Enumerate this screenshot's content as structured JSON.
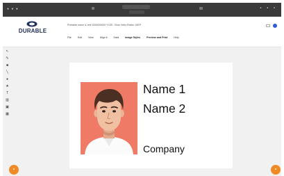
{
  "app": {
    "brand": "DURABLE",
    "tagline": "",
    "file_title": "Printable name & text 0000000000 YLEE. Shoe Hello Ration 15EP"
  },
  "menu": {
    "items": [
      "File",
      "Edit",
      "View",
      "Align it",
      "Data",
      "Image Styles",
      "Preview and Print",
      "Help"
    ]
  },
  "header_right": {
    "left_text": "",
    "button_label": "",
    "avatar_color": "#2f5ad8"
  },
  "tools": [
    {
      "icon": "cursor-icon"
    },
    {
      "icon": "pen-icon"
    },
    {
      "icon": "rectangle-icon"
    },
    {
      "icon": "line-icon"
    },
    {
      "icon": "ellipse-icon"
    },
    {
      "icon": "star-icon"
    },
    {
      "icon": "text-icon"
    },
    {
      "icon": "barcode-icon"
    },
    {
      "icon": "image-icon"
    },
    {
      "icon": "table-icon"
    }
  ],
  "label": {
    "name1": "Name 1",
    "name2": "Name 2",
    "company": "Company",
    "photo_bg_color": "#ef7b67"
  },
  "colors": {
    "accent_orange": "#f08a24",
    "brand_navy": "#1f2e5a"
  }
}
